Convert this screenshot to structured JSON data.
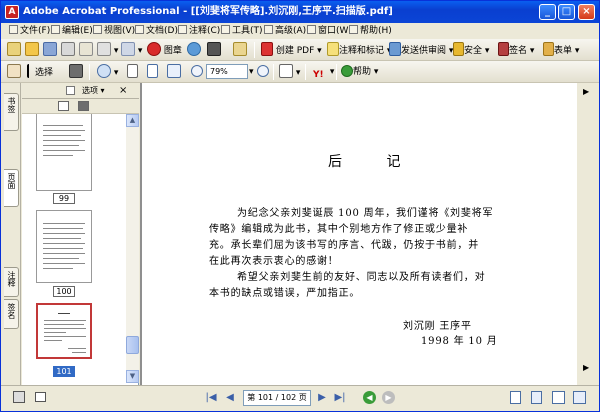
{
  "window": {
    "title": "Adobe Acrobat Professional - [[刘斐将军传略].刘沉刚,王序平.扫描版.pdf]",
    "icon": "acrobat-icon"
  },
  "menu": [
    "文件(F)",
    "编辑(E)",
    "视图(V)",
    "文档(D)",
    "注释(C)",
    "工具(T)",
    "高级(A)",
    "窗口(W)",
    "帮助(H)"
  ],
  "toolbar1": {
    "tool_label": "图章",
    "create_pdf": "创建 PDF",
    "comment": "注释和标记",
    "send_review": "发送供审阅",
    "secure": "安全",
    "sign": "签名",
    "forms": "表单"
  },
  "toolbar2": {
    "select_label": "选择",
    "zoom_value": "79%",
    "help_label": "帮助"
  },
  "side_tabs": [
    "书签",
    "页面",
    "注释",
    "签名"
  ],
  "panel": {
    "options_label": "选项",
    "pages": [
      "99",
      "100",
      "101"
    ],
    "selected_page": "101"
  },
  "document": {
    "heading": "后 记",
    "lines": [
      "为纪念父亲刘斐诞辰 100 周年，我们谨将《刘斐将军",
      "传略》编辑成为此书，其中个别地方作了修正或少量补",
      "充。承长辈们屈为该书写的序言、代跋，仍按于书前，并",
      "在此再次表示衷心的感谢！",
      "希望父亲刘斐生前的友好、同志以及所有读者们，对",
      "本书的缺点或错误，严加指正。"
    ],
    "signature": "刘沉刚    王序平",
    "date": "1998 年 10 月"
  },
  "status": {
    "page_indicator": "第 101 / 102 页"
  }
}
